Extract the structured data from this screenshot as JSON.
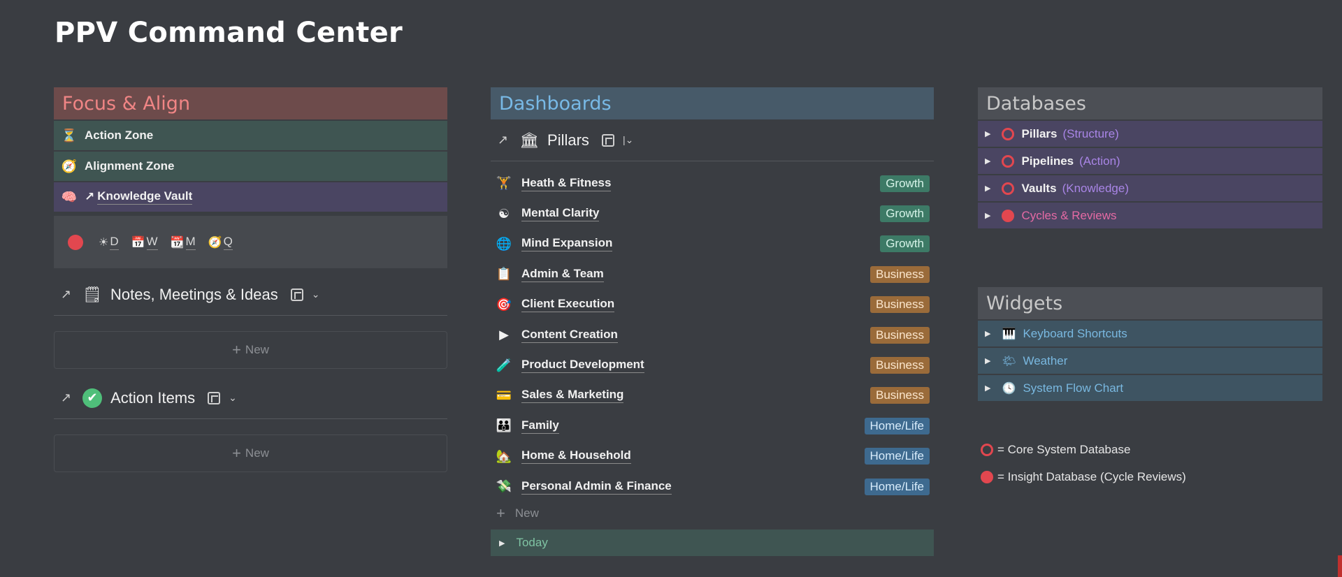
{
  "page": {
    "title": "PPV Command Center"
  },
  "focus": {
    "header": "Focus & Align",
    "zones": [
      {
        "label": "Action Zone",
        "icon": "hourglass-icon",
        "glyph": "⏳"
      },
      {
        "label": "Alignment Zone",
        "icon": "compass-icon",
        "glyph": "🧭"
      },
      {
        "label": "Knowledge Vault",
        "icon": "brain-icon",
        "glyph": "🧠",
        "prefix": "↗"
      }
    ],
    "periods": [
      {
        "label": "D",
        "glyph": "☀"
      },
      {
        "label": "W",
        "glyph": "📅"
      },
      {
        "label": "M",
        "glyph": "📆"
      },
      {
        "label": "Q",
        "glyph": "🧭"
      }
    ],
    "notes": {
      "title": "Notes, Meetings & Ideas",
      "new_label": "New"
    },
    "actions": {
      "title": "Action Items",
      "new_label": "New"
    }
  },
  "dashboards": {
    "header": "Dashboards",
    "view_title": "Pillars",
    "pillars": [
      {
        "name": "Heath & Fitness",
        "tag": "Growth",
        "glyph": "🏋"
      },
      {
        "name": "Mental Clarity",
        "tag": "Growth",
        "glyph": "☯"
      },
      {
        "name": "Mind Expansion",
        "tag": "Growth",
        "glyph": "🌐"
      },
      {
        "name": "Admin & Team",
        "tag": "Business",
        "glyph": "📋"
      },
      {
        "name": "Client Execution",
        "tag": "Business",
        "glyph": "🎯"
      },
      {
        "name": "Content Creation",
        "tag": "Business",
        "glyph": "▶"
      },
      {
        "name": "Product Development",
        "tag": "Business",
        "glyph": "🧪"
      },
      {
        "name": "Sales & Marketing",
        "tag": "Business",
        "glyph": "💳"
      },
      {
        "name": "Family",
        "tag": "Home/Life",
        "glyph": "👪"
      },
      {
        "name": "Home & Household",
        "tag": "Home/Life",
        "glyph": "🏡"
      },
      {
        "name": "Personal Admin & Finance",
        "tag": "Home/Life",
        "glyph": "💸"
      }
    ],
    "new_label": "New",
    "today_label": "Today"
  },
  "databases": {
    "header": "Databases",
    "items": [
      {
        "name": "Pillars",
        "sub": "(Structure)",
        "kind": "core"
      },
      {
        "name": "Pipelines",
        "sub": "(Action)",
        "kind": "core"
      },
      {
        "name": "Vaults",
        "sub": "(Knowledge)",
        "kind": "core"
      },
      {
        "name": "Cycles & Reviews",
        "sub": "",
        "kind": "insight"
      }
    ]
  },
  "widgets": {
    "header": "Widgets",
    "items": [
      {
        "label": "Keyboard Shortcuts",
        "glyph": "🎹"
      },
      {
        "label": "Weather",
        "glyph": "🌤"
      },
      {
        "label": "System Flow Chart",
        "glyph": "🕓"
      }
    ]
  },
  "legend": {
    "core": "= Core System Database",
    "insight": "= Insight Database (Cycle Reviews)"
  },
  "colors": {
    "background": "#3a3d42",
    "focus_header": "#6d4b4b",
    "dashboards_header": "#475a69",
    "core_red": "#e2474f",
    "growth": "#3d7a66",
    "business": "#9a6b3a",
    "home_life": "#3e6a8f"
  }
}
